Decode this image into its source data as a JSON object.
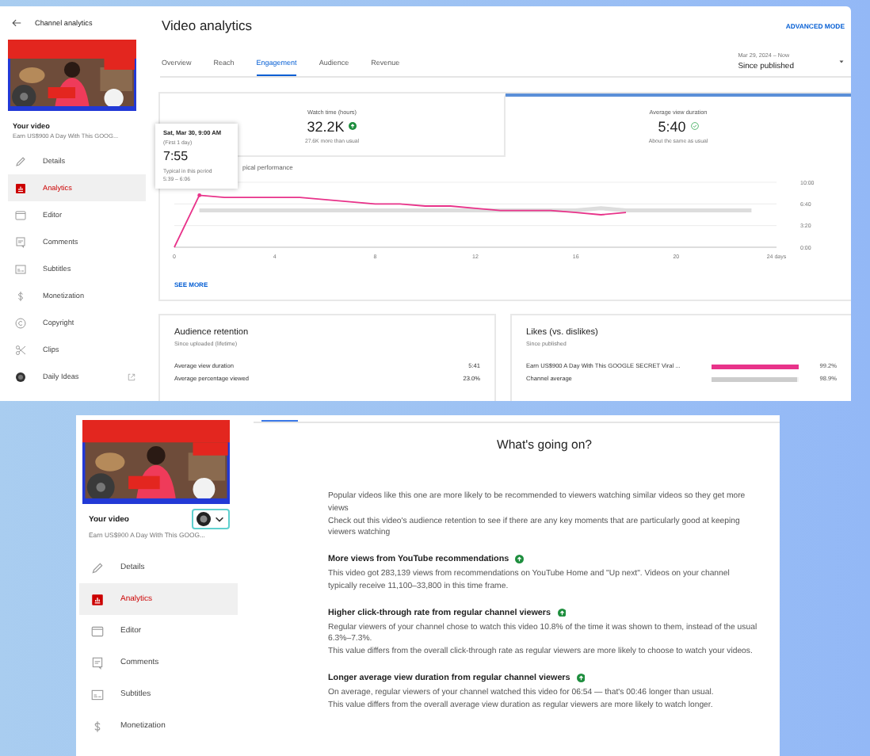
{
  "analytics_screen": {
    "sidebar": {
      "title": "Channel analytics",
      "section_label": "Your video",
      "video_title": "Earn US$900 A Day With This GOOG...",
      "items": [
        {
          "label": "Details",
          "selected": false,
          "external_link": false
        },
        {
          "label": "Analytics",
          "selected": true,
          "external_link": false
        },
        {
          "label": "Editor",
          "selected": false,
          "external_link": false
        },
        {
          "label": "Comments",
          "selected": false,
          "external_link": false
        },
        {
          "label": "Subtitles",
          "selected": false,
          "external_link": false
        },
        {
          "label": "Monetization",
          "selected": false,
          "external_link": false
        },
        {
          "label": "Copyright",
          "selected": false,
          "external_link": false
        },
        {
          "label": "Clips",
          "selected": false,
          "external_link": false
        },
        {
          "label": "Daily Ideas",
          "selected": false,
          "external_link": true
        }
      ]
    },
    "page": {
      "title": "Video analytics",
      "advanced_mode": "ADVANCED MODE",
      "tabs": [
        {
          "label": "Overview",
          "selected": false
        },
        {
          "label": "Reach",
          "selected": false
        },
        {
          "label": "Engagement",
          "selected": true
        },
        {
          "label": "Audience",
          "selected": false
        },
        {
          "label": "Revenue",
          "selected": false
        }
      ],
      "date_range": {
        "dates": "Mar 29, 2024 – Now",
        "label": "Since published"
      },
      "metrics": [
        {
          "label": "Watch time (hours)",
          "value": "32.2K",
          "kind": "up",
          "note": "27.6K more than usual",
          "selected": false
        },
        {
          "label": "Average view duration",
          "value": "5:40",
          "kind": "same",
          "note": "About the same as usual",
          "selected": true
        }
      ],
      "tooltip": {
        "date": "Sat, Mar 30, 9:00 AM",
        "period": "(First 1 day)",
        "value": "7:55",
        "typical_label": "Typical in this period",
        "typical_range": "5:39 – 6:06"
      },
      "legend": "pical performance",
      "chart_data": {
        "type": "line",
        "x": [
          0,
          1,
          2,
          3,
          4,
          5,
          6,
          7,
          8,
          9,
          10,
          11,
          12,
          13,
          14,
          15,
          16,
          17,
          18,
          19,
          20,
          21,
          22,
          23
        ],
        "xlim": [
          0,
          24
        ],
        "ylim": [
          0,
          600
        ],
        "xticks": [
          {
            "value": 0,
            "label": "0"
          },
          {
            "value": 4,
            "label": "4"
          },
          {
            "value": 8,
            "label": "8"
          },
          {
            "value": 12,
            "label": "12"
          },
          {
            "value": 16,
            "label": "16"
          },
          {
            "value": 20,
            "label": "20"
          },
          {
            "value": 24,
            "label": "24 days"
          }
        ],
        "yticks": [
          {
            "value": 0,
            "label": "0:00"
          },
          {
            "value": 200,
            "label": "3:20"
          },
          {
            "value": 400,
            "label": "6:40"
          },
          {
            "value": 600,
            "label": "10:00"
          }
        ],
        "series": [
          {
            "color": "#e8338a",
            "values": [
              0,
              480,
              460,
              460,
              460,
              460,
              440,
              420,
              400,
              400,
              380,
              380,
              360,
              340,
              340,
              340,
              320,
              300,
              320,
              null,
              null,
              null,
              null,
              null
            ]
          },
          {
            "color": "#dddddd",
            "values": [
              null,
              340,
              340,
              340,
              340,
              340,
              340,
              340,
              340,
              340,
              340,
              340,
              340,
              340,
              340,
              340,
              340,
              360,
              340,
              340,
              340,
              340,
              340,
              340
            ]
          }
        ]
      },
      "see_more": "SEE MORE",
      "retention": {
        "title": "Audience retention",
        "subtitle": "Since uploaded (lifetime)",
        "rows": [
          {
            "label": "Average view duration",
            "value": "5:41"
          },
          {
            "label": "Average percentage viewed",
            "value": "23.0%"
          }
        ]
      },
      "likes": {
        "title": "Likes (vs. dislikes)",
        "subtitle": "Since published",
        "rows": [
          {
            "label": "Earn US$900 A Day With This GOOGLE SECRET Viral ...",
            "level": 0.992,
            "color": "#e8338a",
            "value": "99.2%"
          },
          {
            "label": "Channel average",
            "level": 0.989,
            "color": "#cccccc",
            "value": "98.9%"
          }
        ]
      }
    }
  },
  "insights_screen": {
    "sidebar": {
      "section_label": "Your video",
      "avatar_menu": true,
      "video_title": "Earn US$900 A Day With This GOOG...",
      "items": [
        {
          "label": "Details",
          "selected": false,
          "external_link": false
        },
        {
          "label": "Analytics",
          "selected": true,
          "external_link": false
        },
        {
          "label": "Editor",
          "selected": false,
          "external_link": false
        },
        {
          "label": "Comments",
          "selected": false,
          "external_link": false
        },
        {
          "label": "Subtitles",
          "selected": false,
          "external_link": false
        },
        {
          "label": "Monetization",
          "selected": false,
          "external_link": false
        }
      ]
    },
    "page": {
      "title": "What's going on?",
      "intro": [
        "Popular videos like this one are more likely to be recommended to viewers watching similar videos so they get more views",
        "Check out this video's audience retention to see if there are any key moments that are particularly good at keeping viewers watching"
      ],
      "sections": [
        {
          "heading": "More views from YouTube recommendations",
          "paragraphs": [
            "This video got 283,139 views from recommendations on YouTube Home and \"Up next\". Videos on your channel typically receive 11,100–33,800 in this time frame."
          ]
        },
        {
          "heading": "Higher click-through rate from regular channel viewers",
          "paragraphs": [
            "Regular viewers of your channel chose to watch this video 10.8% of the time it was shown to them, instead of the usual 6.3%–7.3%.",
            "This value differs from the overall click-through rate as regular viewers are more likely to choose to watch your videos."
          ]
        },
        {
          "heading": "Longer average view duration from regular channel viewers",
          "paragraphs": [
            "On average, regular viewers of your channel watched this video for 06:54 — that's 00:46 longer than usual.",
            "This value differs from the overall average view duration as regular viewers are more likely to watch longer."
          ]
        }
      ]
    }
  }
}
